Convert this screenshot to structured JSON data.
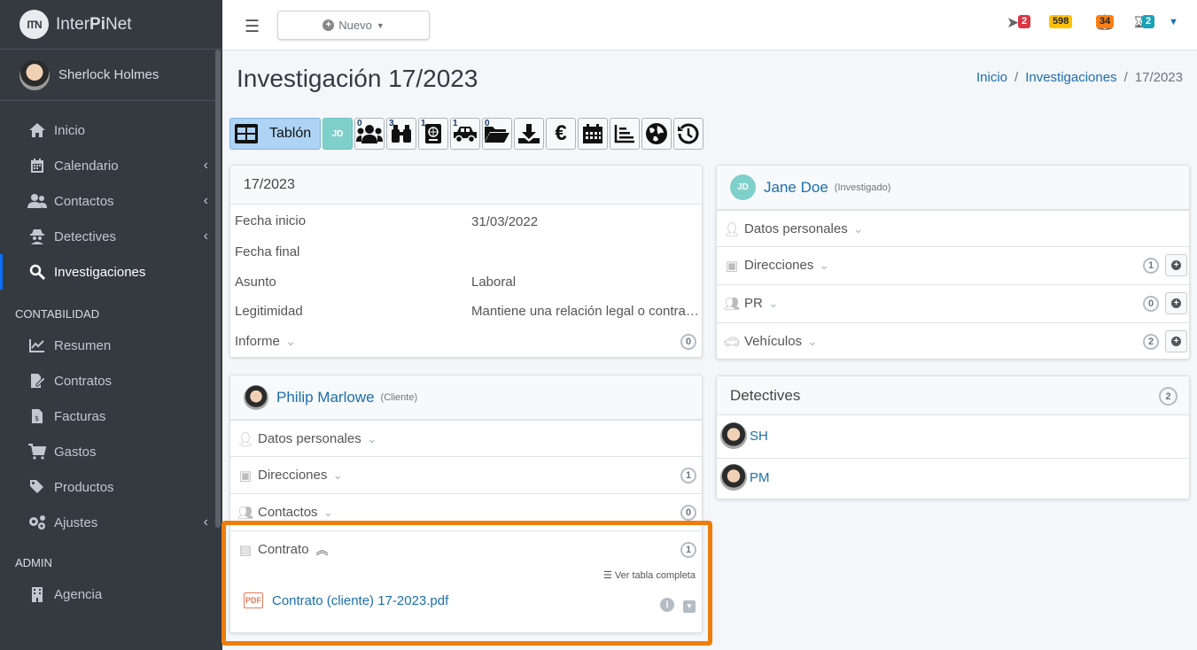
{
  "brand": {
    "logo": "ITN",
    "name_prefix": "Inter",
    "name_bold": "Pi",
    "name_suffix": "Net"
  },
  "user": {
    "name": "Sherlock Holmes"
  },
  "nav": {
    "items": [
      {
        "label": "Inicio",
        "icon": "home-icon"
      },
      {
        "label": "Calendario",
        "icon": "calendar-icon"
      },
      {
        "label": "Contactos",
        "icon": "users-icon"
      },
      {
        "label": "Detectives",
        "icon": "detective-icon"
      },
      {
        "label": "Investigaciones",
        "icon": "search-icon"
      }
    ],
    "header_contabilidad": "CONTABILIDAD",
    "contabilidad": [
      {
        "label": "Resumen",
        "icon": "chart-line-icon"
      },
      {
        "label": "Contratos",
        "icon": "contract-icon"
      },
      {
        "label": "Facturas",
        "icon": "invoice-icon"
      },
      {
        "label": "Gastos",
        "icon": "cart-icon"
      },
      {
        "label": "Productos",
        "icon": "tags-icon"
      },
      {
        "label": "Ajustes",
        "icon": "cogs-icon"
      }
    ],
    "header_admin": "ADMIN",
    "admin": [
      {
        "label": "Agencia",
        "icon": "building-icon"
      }
    ]
  },
  "topbar": {
    "nuevo": "Nuevo",
    "badges": {
      "messages": "2",
      "tasks": "598",
      "alerts": "34",
      "timers": "2"
    }
  },
  "page": {
    "title": "Investigación 17/2023",
    "breadcrumb": {
      "home": "Inicio",
      "section": "Investigaciones",
      "current": "17/2023"
    }
  },
  "toolbar": {
    "tablon": "Tablón",
    "jd": "JD",
    "counts": {
      "people": "0",
      "binoculars": "3",
      "passport": "1",
      "car": "1",
      "folder": "0"
    }
  },
  "case": {
    "header": "17/2023",
    "fecha_inicio_label": "Fecha inicio",
    "fecha_inicio": "31/03/2022",
    "fecha_final_label": "Fecha final",
    "asunto_label": "Asunto",
    "asunto": "Laboral",
    "legitimidad_label": "Legitimidad",
    "legitimidad": "Mantiene una relación legal o contra…",
    "informe_label": "Informe",
    "informe_count": "0"
  },
  "client": {
    "name": "Philip Marlowe",
    "role": "(Cliente)",
    "datos": "Datos personales",
    "direcciones": "Direcciones",
    "direcciones_count": "1",
    "contactos": "Contactos",
    "contactos_count": "0",
    "contrato": "Contrato",
    "contrato_count": "1",
    "ver_tabla": "Ver tabla completa",
    "file": "Contrato (cliente) 17-2023.pdf"
  },
  "investigado": {
    "initials": "JD",
    "name": "Jane Doe",
    "role": "(Investigado)",
    "datos": "Datos personales",
    "direcciones": "Direcciones",
    "direcciones_count": "1",
    "pr": "PR",
    "pr_count": "0",
    "vehiculos": "Vehículos",
    "vehiculos_count": "2"
  },
  "detectives": {
    "title": "Detectives",
    "count": "2",
    "list": [
      {
        "code": "SH"
      },
      {
        "code": "PM"
      }
    ]
  }
}
